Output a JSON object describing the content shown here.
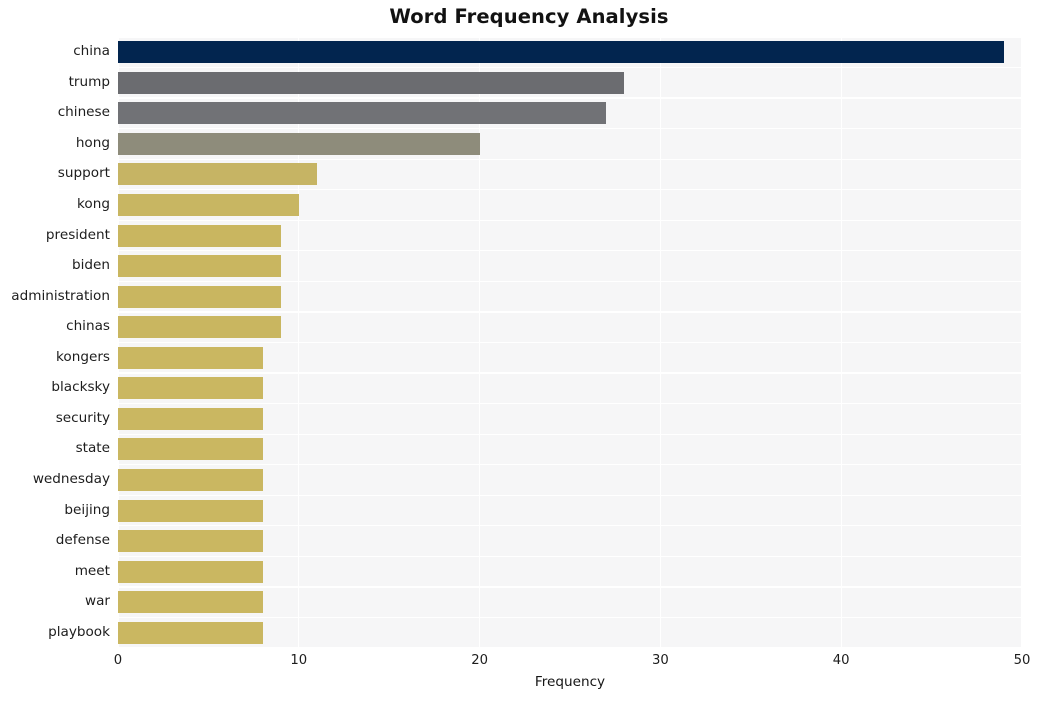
{
  "chart_data": {
    "type": "bar",
    "orientation": "horizontal",
    "title": "Word Frequency Analysis",
    "xlabel": "Frequency",
    "ylabel": "",
    "xlim": [
      0,
      50
    ],
    "ylim_categories": 20,
    "grid": true,
    "legend": null,
    "xticks": [
      "0",
      "10",
      "20",
      "30",
      "40",
      "50"
    ],
    "xtick_values": [
      0,
      10,
      20,
      30,
      40,
      50
    ],
    "categories": [
      "china",
      "trump",
      "chinese",
      "hong",
      "support",
      "kong",
      "president",
      "biden",
      "administration",
      "chinas",
      "kongers",
      "blacksky",
      "security",
      "state",
      "wednesday",
      "beijing",
      "defense",
      "meet",
      "war",
      "playbook"
    ],
    "values": [
      49,
      28,
      27,
      20,
      11,
      10,
      9,
      9,
      9,
      9,
      8,
      8,
      8,
      8,
      8,
      8,
      8,
      8,
      8,
      8
    ],
    "bar_colors": [
      "#02254f",
      "#6b6c70",
      "#717276",
      "#8e8c7b",
      "#c6b464",
      "#c8b662",
      "#c9b660",
      "#c9b660",
      "#c9b660",
      "#c9b660",
      "#cab761",
      "#cab761",
      "#cab761",
      "#cab761",
      "#cab761",
      "#cab761",
      "#cab761",
      "#cab761",
      "#cab761",
      "#cab761"
    ]
  },
  "style": {
    "figure_background": "#ffffff",
    "plot_background": "#f6f6f7",
    "gridline_color": "#ffffff",
    "text_color": "#1d1d1d",
    "title_color": "#121212"
  }
}
